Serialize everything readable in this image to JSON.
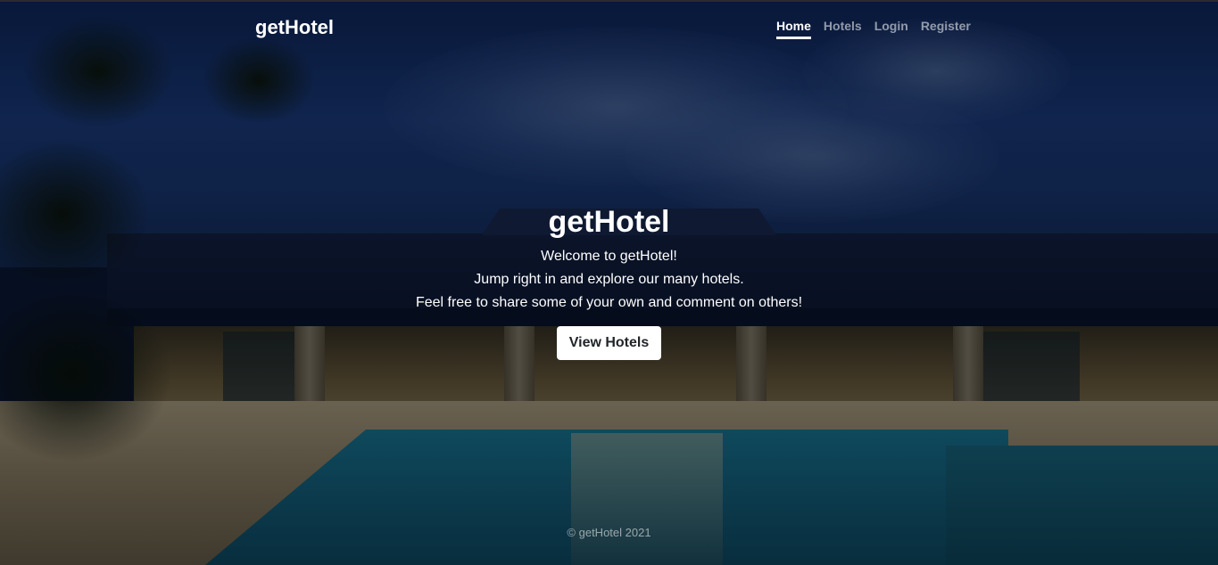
{
  "navbar": {
    "brand": "getHotel",
    "links": [
      {
        "label": "Home",
        "active": true
      },
      {
        "label": "Hotels",
        "active": false
      },
      {
        "label": "Login",
        "active": false
      },
      {
        "label": "Register",
        "active": false
      }
    ]
  },
  "hero": {
    "title": "getHotel",
    "lines": [
      "Welcome to getHotel!",
      "Jump right in and explore our many hotels.",
      "Feel free to share some of your own and comment on others!"
    ],
    "button_label": "View Hotels"
  },
  "footer": {
    "text": "© getHotel 2021"
  },
  "colors": {
    "text": "#ffffff",
    "muted_link": "rgba(255,255,255,0.55)",
    "button_bg": "#ffffff",
    "button_text": "#212529"
  }
}
